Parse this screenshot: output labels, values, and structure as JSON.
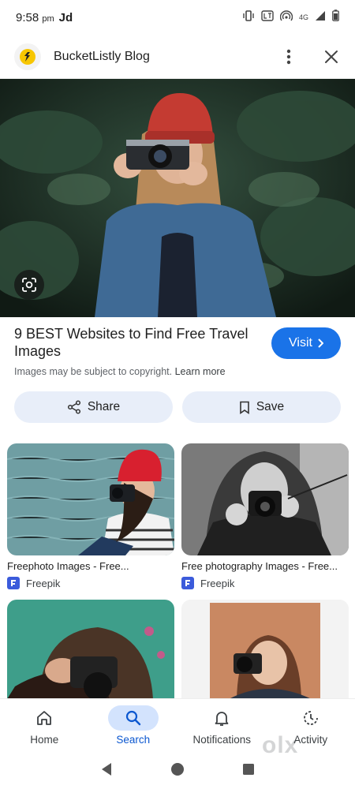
{
  "status": {
    "time": "9:58",
    "ampm": "pm",
    "carrier": "Jd",
    "network": "4G"
  },
  "header": {
    "title": "BucketListly Blog"
  },
  "result": {
    "title": "9 BEST Websites to Find Free Travel Images",
    "visit_label": "Visit",
    "copyright_text": "Images may be subject to copyright.",
    "learn_more": "Learn more"
  },
  "actions": {
    "share_label": "Share",
    "save_label": "Save"
  },
  "related": [
    {
      "caption": "Freephoto Images - Free...",
      "source": "Freepik"
    },
    {
      "caption": "Free photography Images - Free...",
      "source": "Freepik"
    }
  ],
  "bottom_nav": {
    "items": [
      {
        "label": "Home"
      },
      {
        "label": "Search"
      },
      {
        "label": "Notifications"
      },
      {
        "label": "Activity"
      }
    ]
  },
  "watermark": "olx",
  "colors": {
    "accent": "#1a73e8",
    "action_bg": "#e8eef9",
    "nav_active_bg": "#d3e3fd"
  }
}
